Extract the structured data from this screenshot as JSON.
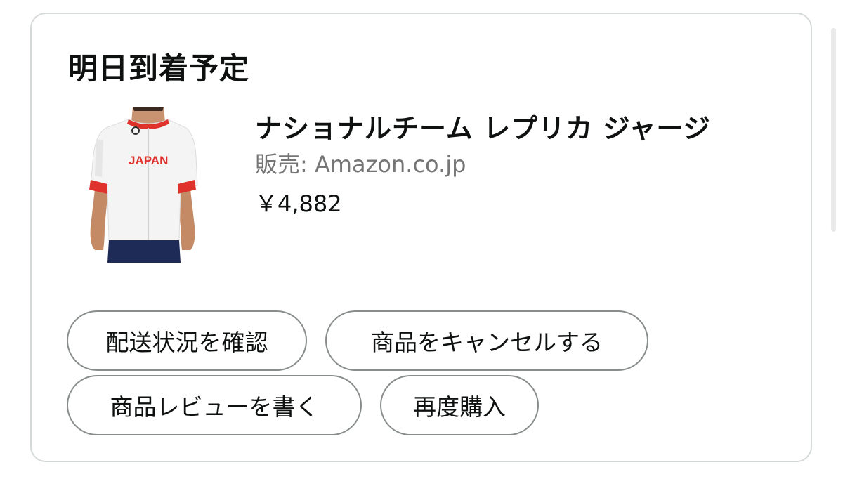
{
  "delivery": {
    "heading": "明日到着予定"
  },
  "product": {
    "title": "ナショナルチーム レプリカ ジャージ",
    "seller": "販売: Amazon.co.jp",
    "price": "￥4,882",
    "image_text": "JAPAN",
    "image_icon": "cycling-jersey-icon"
  },
  "actions": {
    "track": "配送状況を確認",
    "cancel": "商品をキャンセルする",
    "review": "商品レビューを書く",
    "rebuy": "再度購入"
  },
  "colors": {
    "card_border": "#d5d9d9",
    "pill_border": "#888c8c",
    "accent_red": "#e0322d",
    "shorts_navy": "#1e2b57"
  }
}
